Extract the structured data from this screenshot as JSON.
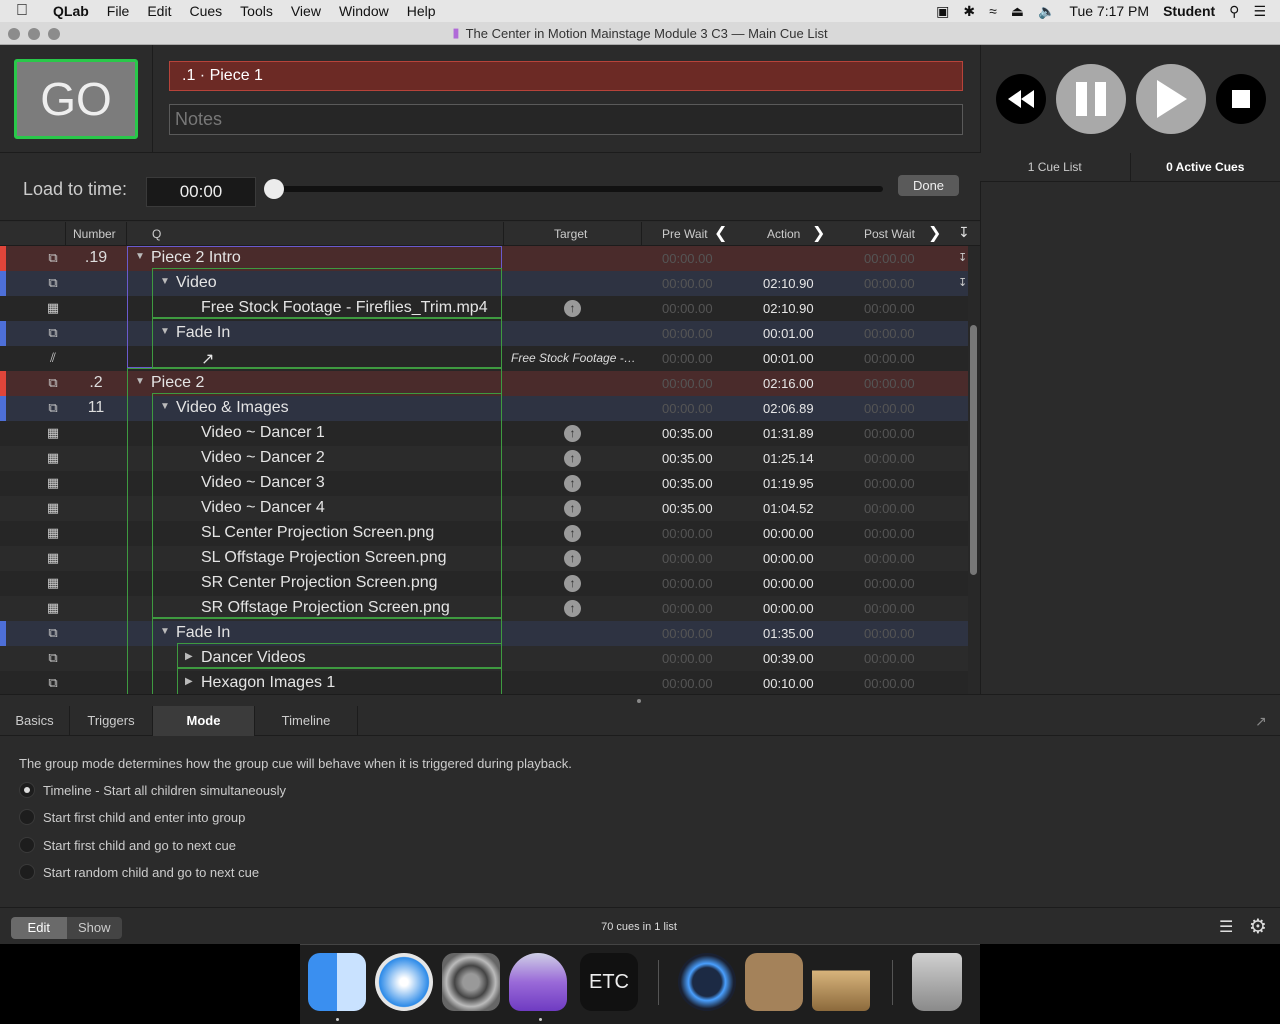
{
  "menubar": {
    "app": "QLab",
    "items": [
      "File",
      "Edit",
      "Cues",
      "Tools",
      "View",
      "Window",
      "Help"
    ],
    "clock": "Tue 7:17 PM",
    "user": "Student"
  },
  "window": {
    "title": "The Center in Motion Mainstage Module 3 C3 — Main Cue List"
  },
  "go": {
    "label": "GO",
    "cue_name": ".1 · Piece 1",
    "notes_placeholder": "Notes"
  },
  "load": {
    "label": "Load to time:",
    "time": "00:00",
    "position": 0,
    "done": "Done"
  },
  "cue_lists": {
    "count": "1 Cue List",
    "active": "0 Active Cues"
  },
  "table": {
    "columns": {
      "number": "Number",
      "q": "Q",
      "target": "Target",
      "pre_wait": "Pre Wait",
      "action": "Action",
      "post_wait": "Post Wait"
    },
    "rows": [
      {
        "icon": "group-icon",
        "number": ".19",
        "name": "Piece 2 Intro",
        "indent": 0,
        "disclosure": "open",
        "target": "",
        "target_icon": false,
        "pre_wait": "00:00.00",
        "action": "",
        "post_wait": "00:00.00",
        "stripe": "#e0453a",
        "bg": "#4a2b2b"
      },
      {
        "icon": "group-icon",
        "number": "",
        "name": "Video",
        "indent": 1,
        "disclosure": "open",
        "target": "",
        "target_icon": false,
        "pre_wait": "00:00.00",
        "action": "02:10.90",
        "post_wait": "00:00.00",
        "stripe": "#4d6fd8",
        "bg": "#2e3342"
      },
      {
        "icon": "video-icon",
        "number": "",
        "name": "Free Stock Footage - Fireflies_Trim.mp4",
        "indent": 2,
        "disclosure": "",
        "target": "",
        "target_icon": true,
        "pre_wait": "00:00.00",
        "action": "02:10.90",
        "post_wait": "00:00.00",
        "stripe": "",
        "bg": "#262626"
      },
      {
        "icon": "group-icon",
        "number": "",
        "name": "Fade In",
        "indent": 1,
        "disclosure": "open",
        "target": "",
        "target_icon": false,
        "pre_wait": "00:00.00",
        "action": "00:01.00",
        "post_wait": "00:00.00",
        "stripe": "#4d6fd8",
        "bg": "#2e3342"
      },
      {
        "icon": "fade-icon",
        "number": "",
        "name": "↗",
        "indent": 2,
        "disclosure": "",
        "target": "Free Stock Footage -…",
        "target_icon": false,
        "pre_wait": "00:00.00",
        "action": "00:01.00",
        "post_wait": "00:00.00",
        "stripe": "",
        "bg": "#262626"
      },
      {
        "icon": "group-icon",
        "number": ".2",
        "name": "Piece 2",
        "indent": 0,
        "disclosure": "open",
        "target": "",
        "target_icon": false,
        "pre_wait": "00:00.00",
        "action": "02:16.00",
        "post_wait": "00:00.00",
        "stripe": "#e0453a",
        "bg": "#4a2b2b"
      },
      {
        "icon": "group-icon",
        "number": "11",
        "name": "Video & Images",
        "indent": 1,
        "disclosure": "open",
        "target": "",
        "target_icon": false,
        "pre_wait": "00:00.00",
        "action": "02:06.89",
        "post_wait": "00:00.00",
        "stripe": "#4d6fd8",
        "bg": "#2e3342"
      },
      {
        "icon": "video-icon",
        "number": "",
        "name": "Video ~ Dancer 1",
        "indent": 2,
        "disclosure": "",
        "target": "",
        "target_icon": true,
        "pre_wait": "00:35.00",
        "action": "01:31.89",
        "post_wait": "00:00.00",
        "stripe": "",
        "bg": "#262626"
      },
      {
        "icon": "video-icon",
        "number": "",
        "name": "Video ~ Dancer 2",
        "indent": 2,
        "disclosure": "",
        "target": "",
        "target_icon": true,
        "pre_wait": "00:35.00",
        "action": "01:25.14",
        "post_wait": "00:00.00",
        "stripe": "",
        "bg": "#2b2b2b"
      },
      {
        "icon": "video-icon",
        "number": "",
        "name": "Video ~ Dancer 3",
        "indent": 2,
        "disclosure": "",
        "target": "",
        "target_icon": true,
        "pre_wait": "00:35.00",
        "action": "01:19.95",
        "post_wait": "00:00.00",
        "stripe": "",
        "bg": "#262626"
      },
      {
        "icon": "video-icon",
        "number": "",
        "name": "Video ~ Dancer 4",
        "indent": 2,
        "disclosure": "",
        "target": "",
        "target_icon": true,
        "pre_wait": "00:35.00",
        "action": "01:04.52",
        "post_wait": "00:00.00",
        "stripe": "",
        "bg": "#2b2b2b"
      },
      {
        "icon": "video-icon",
        "number": "",
        "name": "SL Center Projection Screen.png",
        "indent": 2,
        "disclosure": "",
        "target": "",
        "target_icon": true,
        "pre_wait": "00:00.00",
        "action": "00:00.00",
        "post_wait": "00:00.00",
        "stripe": "",
        "bg": "#262626"
      },
      {
        "icon": "video-icon",
        "number": "",
        "name": "SL Offstage Projection Screen.png",
        "indent": 2,
        "disclosure": "",
        "target": "",
        "target_icon": true,
        "pre_wait": "00:00.00",
        "action": "00:00.00",
        "post_wait": "00:00.00",
        "stripe": "",
        "bg": "#2b2b2b"
      },
      {
        "icon": "video-icon",
        "number": "",
        "name": "SR Center Projection Screen.png",
        "indent": 2,
        "disclosure": "",
        "target": "",
        "target_icon": true,
        "pre_wait": "00:00.00",
        "action": "00:00.00",
        "post_wait": "00:00.00",
        "stripe": "",
        "bg": "#262626"
      },
      {
        "icon": "video-icon",
        "number": "",
        "name": "SR Offstage Projection Screen.png",
        "indent": 2,
        "disclosure": "",
        "target": "",
        "target_icon": true,
        "pre_wait": "00:00.00",
        "action": "00:00.00",
        "post_wait": "00:00.00",
        "stripe": "",
        "bg": "#2b2b2b"
      },
      {
        "icon": "group-icon",
        "number": "",
        "name": "Fade In",
        "indent": 1,
        "disclosure": "open",
        "target": "",
        "target_icon": false,
        "pre_wait": "00:00.00",
        "action": "01:35.00",
        "post_wait": "00:00.00",
        "stripe": "#4d6fd8",
        "bg": "#2e3342"
      },
      {
        "icon": "group-icon",
        "number": "",
        "name": "Dancer Videos",
        "indent": 2,
        "disclosure": "closed",
        "target": "",
        "target_icon": false,
        "pre_wait": "00:00.00",
        "action": "00:39.00",
        "post_wait": "00:00.00",
        "stripe": "",
        "bg": "#2b2b2b"
      },
      {
        "icon": "group-icon",
        "number": "",
        "name": "Hexagon Images 1",
        "indent": 2,
        "disclosure": "closed",
        "target": "",
        "target_icon": false,
        "pre_wait": "00:00.00",
        "action": "00:10.00",
        "post_wait": "00:00.00",
        "stripe": "",
        "bg": "#262626"
      }
    ]
  },
  "inspector": {
    "tabs": [
      "Basics",
      "Triggers",
      "Mode",
      "Timeline"
    ],
    "selected_tab": "Mode",
    "description": "The group mode determines how the group cue will behave when it is triggered during playback.",
    "options": [
      {
        "label": "Timeline - Start all children simultaneously",
        "selected": true
      },
      {
        "label": "Start first child and enter into group",
        "selected": false
      },
      {
        "label": "Start first child and go to next cue",
        "selected": false
      },
      {
        "label": "Start random child and go to next cue",
        "selected": false
      }
    ]
  },
  "status": {
    "edit": "Edit",
    "show": "Show",
    "count": "70 cues in 1 list"
  },
  "dock": {
    "apps": [
      "finder-icon",
      "safari-icon",
      "system-preferences-icon",
      "qlab-icon",
      "etc-eos-icon",
      "quicktime-icon",
      "contacts-icon",
      "chess-icon",
      "trash-icon"
    ],
    "etc_label": "ETC"
  },
  "colors": {
    "go_border": "#29c84a",
    "group_border": "#3e9a40",
    "selected_cue": "#6c2a25",
    "stripe_red": "#e0453a",
    "stripe_blue": "#4d6fd8"
  }
}
